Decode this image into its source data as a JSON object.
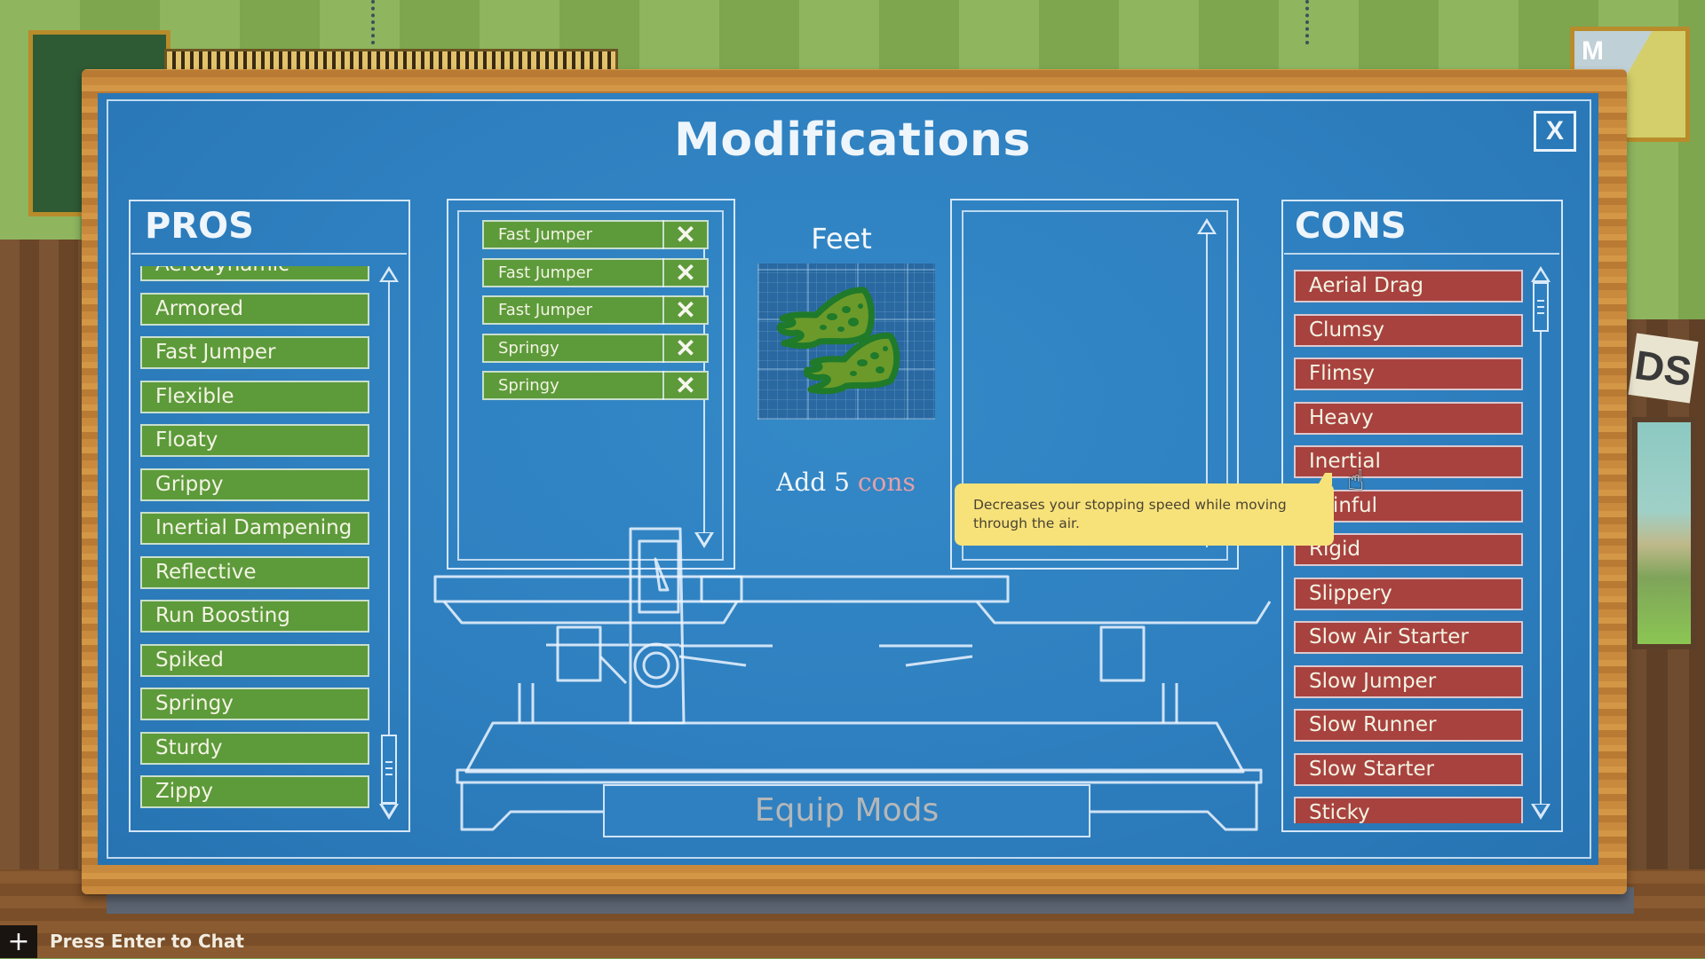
{
  "window": {
    "title": "Modifications",
    "close_label": "X"
  },
  "pros": {
    "heading": "PROS",
    "items": [
      {
        "label": "Aerodynamic",
        "partially_visible": true
      },
      {
        "label": "Armored"
      },
      {
        "label": "Fast Jumper"
      },
      {
        "label": "Flexible"
      },
      {
        "label": "Floaty"
      },
      {
        "label": "Grippy"
      },
      {
        "label": "Inertial Dampening"
      },
      {
        "label": "Reflective"
      },
      {
        "label": "Run Boosting"
      },
      {
        "label": "Spiked"
      },
      {
        "label": "Springy"
      },
      {
        "label": "Sturdy"
      },
      {
        "label": "Zippy"
      }
    ],
    "scroll_position": 1.0,
    "color": "#5d9a3a"
  },
  "selected_pros": {
    "items": [
      {
        "label": "Fast Jumper",
        "remove_label": "✕"
      },
      {
        "label": "Fast Jumper",
        "remove_label": "✕"
      },
      {
        "label": "Fast Jumper",
        "remove_label": "✕"
      },
      {
        "label": "Springy",
        "remove_label": "✕"
      },
      {
        "label": "Springy",
        "remove_label": "✕"
      }
    ]
  },
  "selected_cons": {
    "items": []
  },
  "slot": {
    "name": "Feet",
    "icon": "frog-feet-icon",
    "requirement_prefix": "Add",
    "requirement_count": "5",
    "requirement_suffix": "cons",
    "requirement_accent": "#e3a0a8"
  },
  "cons": {
    "heading": "CONS",
    "items": [
      {
        "label": "Aerial Drag"
      },
      {
        "label": "Clumsy"
      },
      {
        "label": "Flimsy"
      },
      {
        "label": "Heavy"
      },
      {
        "label": "Inertial",
        "hovered": true
      },
      {
        "label": "Painful"
      },
      {
        "label": "Rigid"
      },
      {
        "label": "Slippery"
      },
      {
        "label": "Slow Air Starter"
      },
      {
        "label": "Slow Jumper"
      },
      {
        "label": "Slow Runner"
      },
      {
        "label": "Slow Starter"
      },
      {
        "label": "Sticky",
        "partially_visible": true
      }
    ],
    "scroll_position": 0.0,
    "color": "#a8423f"
  },
  "tooltip": {
    "text": "Decreases your stopping speed while moving through the air."
  },
  "equip_button": {
    "label": "Equip Mods",
    "enabled": false
  },
  "chat": {
    "plus_label": "+",
    "prompt": "Press Enter to Chat"
  },
  "background": {
    "map_letter": "M",
    "sign_text": "DS"
  }
}
